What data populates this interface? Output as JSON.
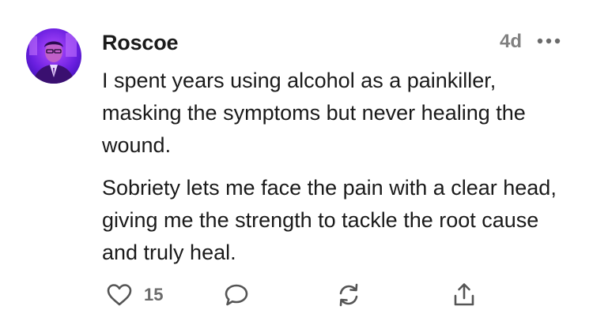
{
  "comment": {
    "author": "Roscoe",
    "timestamp": "4d",
    "paragraphs": [
      "I spent years using alcohol as a painkiller, masking the symptoms but never healing the wound.",
      "Sobriety lets me face the pain with a clear head, giving me the strength to tackle the root cause and truly heal."
    ],
    "likes": "15"
  },
  "icons": {
    "more": "more-horizontal-icon",
    "like": "heart-icon",
    "reply": "speech-bubble-icon",
    "restack": "refresh-cycle-icon",
    "share": "share-upload-icon"
  },
  "colors": {
    "text": "#1a1a1a",
    "muted": "#808080",
    "icon": "#555555",
    "avatar_bg": "#7a1ee8"
  }
}
